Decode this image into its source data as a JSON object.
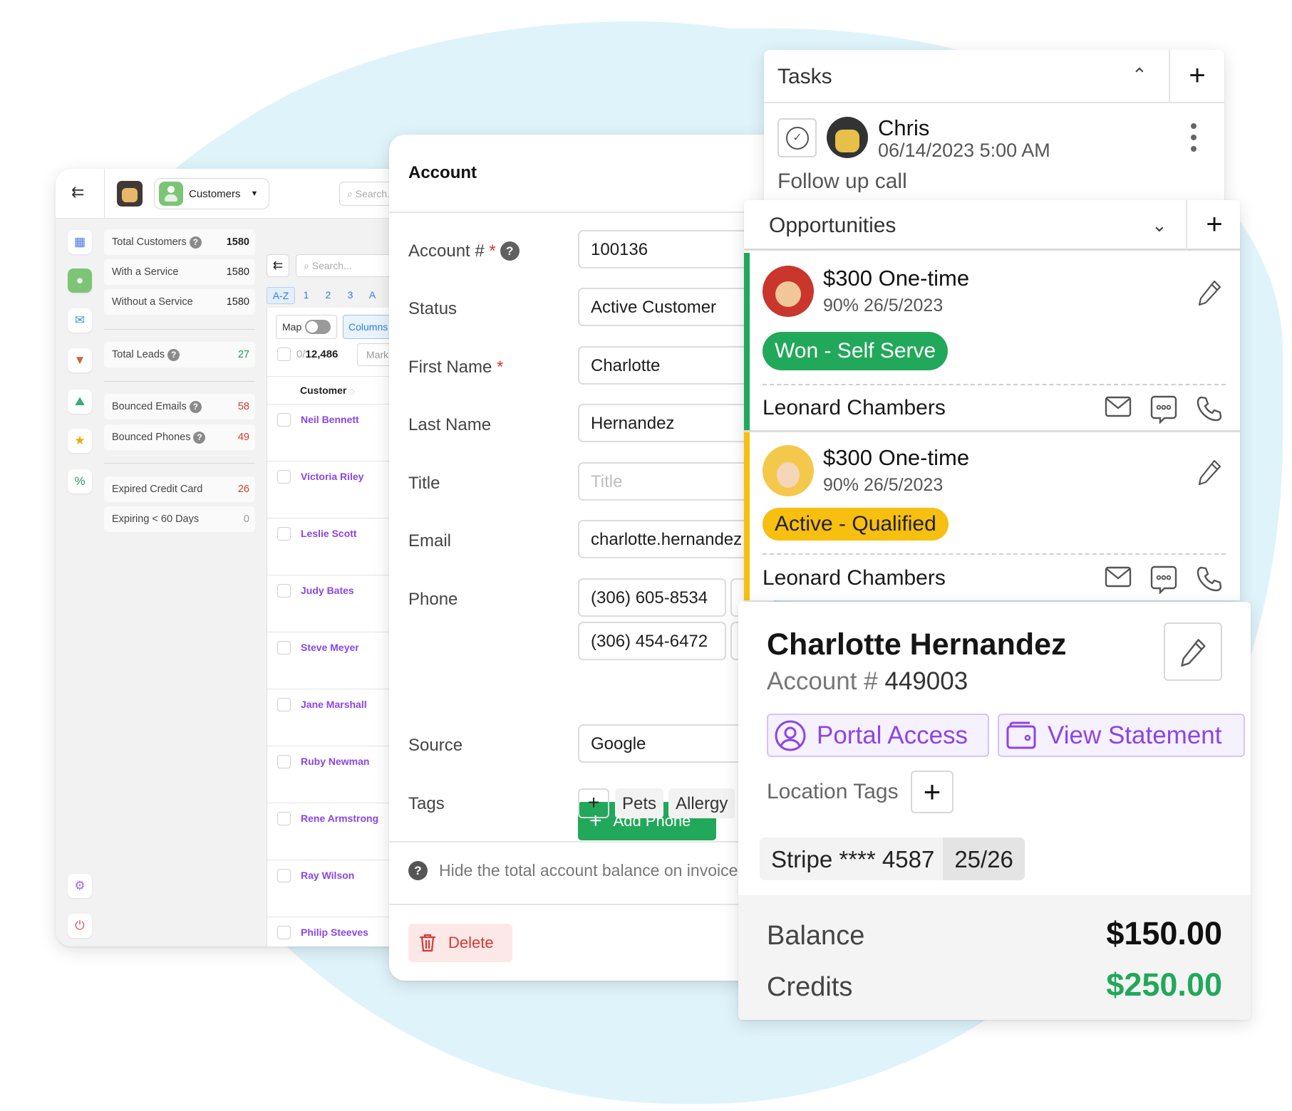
{
  "customers_panel": {
    "module_label": "Customers",
    "top_search_placeholder": "Search...",
    "stats": [
      {
        "label": "Total Customers",
        "value": "1580",
        "help": true
      },
      {
        "label": "With a Service",
        "value": "1580",
        "help": false
      },
      {
        "label": "Without a Service",
        "value": "1580",
        "help": false
      },
      {
        "label": "Total Leads",
        "value": "27",
        "help": true
      },
      {
        "label": "Bounced Emails",
        "value": "58",
        "help": true
      },
      {
        "label": "Bounced Phones",
        "value": "49",
        "help": true
      },
      {
        "label": "Expired Credit Card",
        "value": "26",
        "help": false
      },
      {
        "label": "Expiring < 60 Days",
        "value": "0",
        "help": false
      }
    ],
    "list": {
      "search_placeholder": "Search...",
      "alpha_filters": [
        "A-Z",
        "1",
        "2",
        "3",
        "A"
      ],
      "map_label": "Map",
      "columns_label": "Columns",
      "selected_count": "0",
      "total_count": "12,486",
      "mark_label": "Mark",
      "column_header": "Customer",
      "customers": [
        "Neil Bennett",
        "Victoria Riley",
        "Leslie Scott",
        "Judy Bates",
        "Steve Meyer",
        "Jane Marshall",
        "Ruby Newman",
        "Rene Armstrong",
        "Ray Wilson",
        "Philip Steeves"
      ]
    }
  },
  "account_form": {
    "title": "Account",
    "fields": {
      "account_number": {
        "label": "Account #",
        "value": "100136"
      },
      "status": {
        "label": "Status",
        "value": "Active Customer"
      },
      "first_name": {
        "label": "First Name",
        "value": "Charlotte"
      },
      "last_name": {
        "label": "Last Name",
        "value": "Hernandez"
      },
      "title": {
        "label": "Title",
        "placeholder": "Title"
      },
      "email": {
        "label": "Email",
        "value": "charlotte.hernandez"
      },
      "phone": {
        "label": "Phone",
        "values": [
          "(306) 605-8534",
          "(306) 454-6472"
        ]
      },
      "source": {
        "label": "Source",
        "value": "Google"
      },
      "tags": {
        "label": "Tags",
        "values": [
          "Pets",
          "Allergy"
        ]
      }
    },
    "required_marker": "*",
    "add_phone_label": "Add Phone",
    "hide_balance_note": "Hide the total account balance on invoices",
    "delete_label": "Delete"
  },
  "tasks": {
    "title": "Tasks",
    "items": [
      {
        "assignee": "Chris",
        "datetime": "06/14/2023 5:00 AM",
        "description": "Follow up call"
      }
    ]
  },
  "opportunities": {
    "title": "Opportunities",
    "items": [
      {
        "amount": "$300 One-time",
        "probability": "90%",
        "date": "26/5/2023",
        "stage": "Won - Self Serve",
        "stage_color": "#22a85a",
        "contact": "Leonard Chambers"
      },
      {
        "amount": "$300 One-time",
        "probability": "90%",
        "date": "26/5/2023",
        "stage": "Active - Qualified",
        "stage_color": "#f7bf0f",
        "contact": "Leonard Chambers"
      }
    ]
  },
  "customer_card": {
    "name": "Charlotte Hernandez",
    "account_label": "Account #",
    "account_number": "449003",
    "portal_access_label": "Portal Access",
    "view_statement_label": "View Statement",
    "location_tags_label": "Location Tags",
    "card_label": "Stripe **** 4587",
    "card_expiry": "25/26",
    "balance_label": "Balance",
    "balance_value": "$150.00",
    "credits_label": "Credits",
    "credits_value": "$250.00"
  },
  "colors": {
    "accent_purple": "#8b45e6",
    "success_green": "#22a85a",
    "warning_yellow": "#f7bf0f",
    "danger_red": "#d23b31",
    "link_blue": "#2f7ee0"
  }
}
